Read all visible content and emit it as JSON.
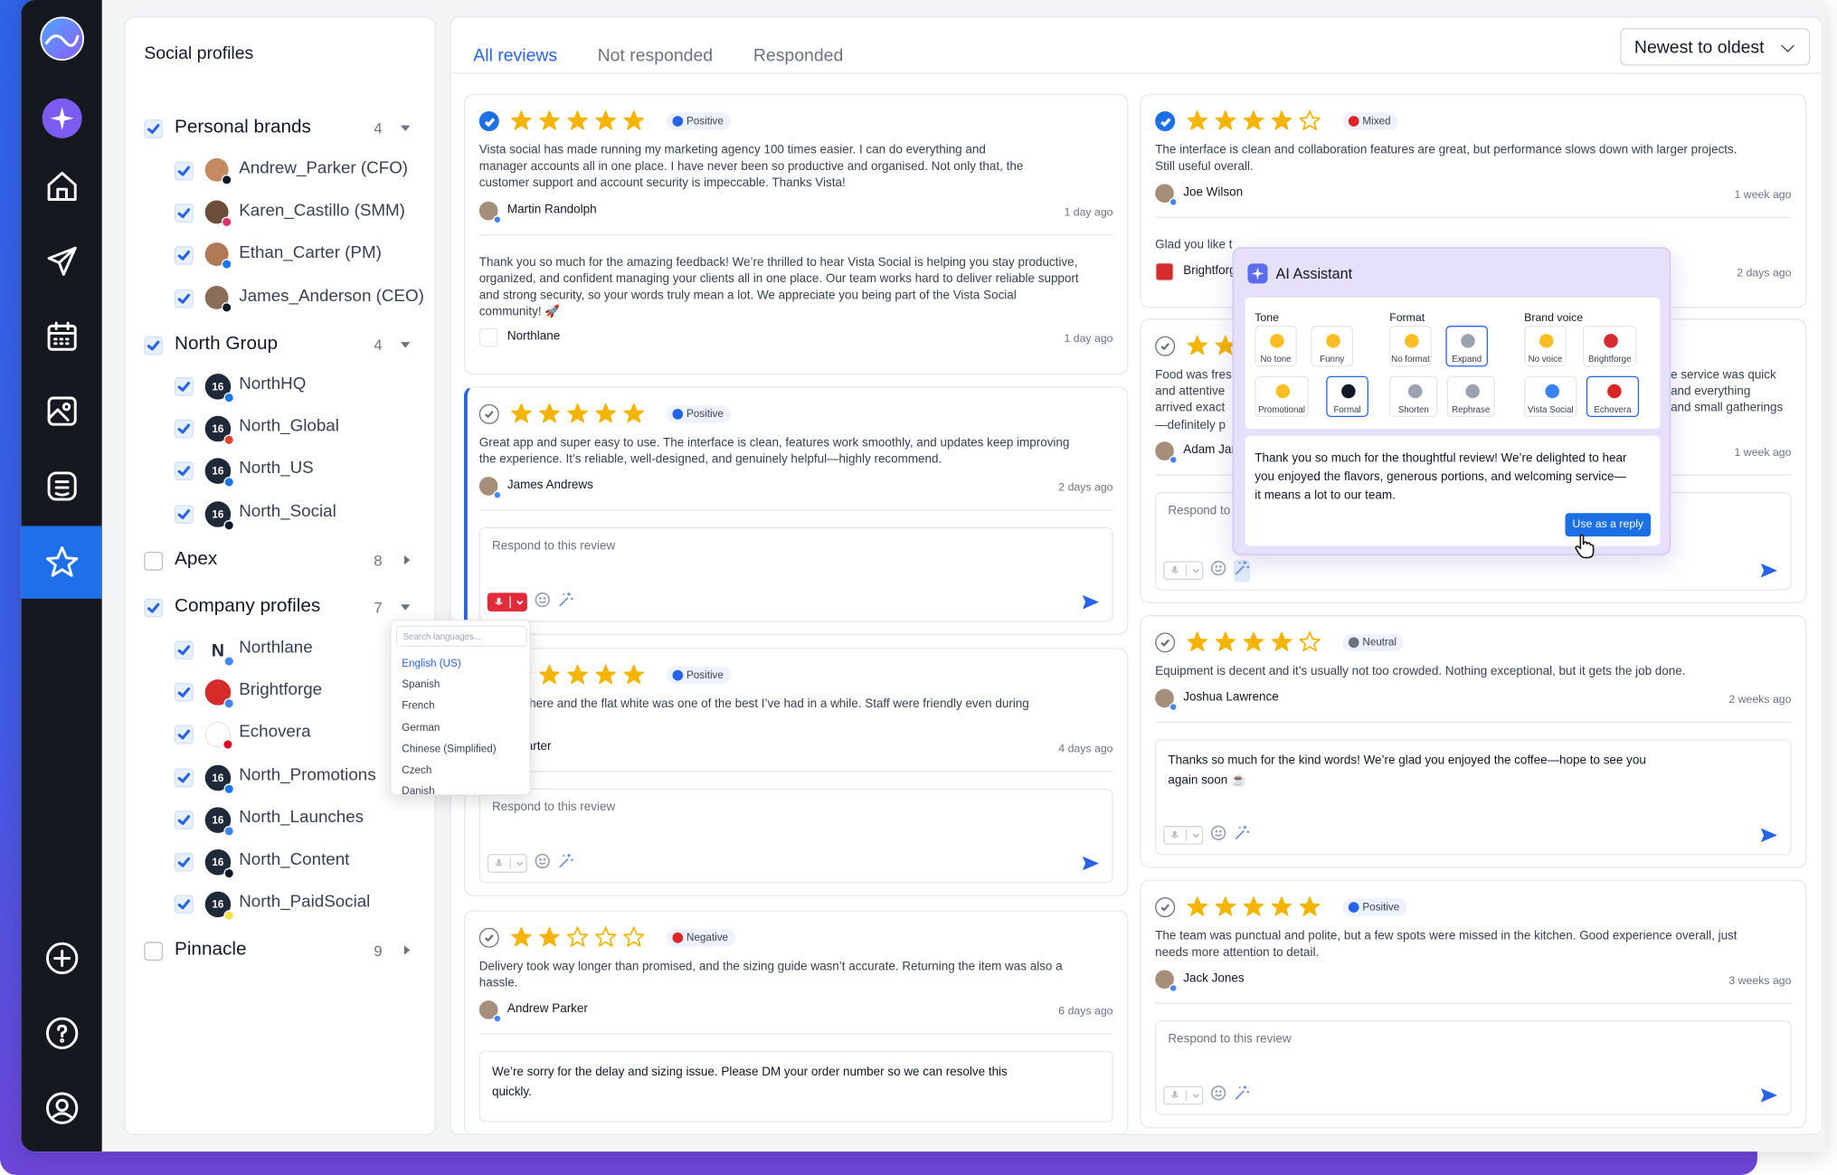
{
  "sidebar": {
    "title": "Social profiles",
    "groups": [
      {
        "label": "Personal brands",
        "count": "4",
        "checked": true,
        "expanded": true,
        "items": [
          "Andrew_Parker (CFO)",
          "Karen_Castillo (SMM)",
          "Ethan_Carter (PM)",
          "James_Anderson (CEO)"
        ]
      },
      {
        "label": "North Group",
        "count": "4",
        "checked": true,
        "expanded": true,
        "items": [
          "NorthHQ",
          "North_Global",
          "North_US",
          "North_Social"
        ]
      },
      {
        "label": "Apex",
        "count": "8",
        "checked": false,
        "expanded": false
      },
      {
        "label": "Company profiles",
        "count": "7",
        "checked": true,
        "expanded": true,
        "items": [
          "Northlane",
          "Brightforge",
          "Echovera",
          "North_Promotions",
          "North_Launches",
          "North_Content",
          "North_PaidSocial"
        ]
      },
      {
        "label": "Pinnacle",
        "count": "9",
        "checked": false,
        "expanded": false
      }
    ]
  },
  "language_dropdown": {
    "placeholder": "Search languages...",
    "options": [
      "English (US)",
      "Spanish",
      "French",
      "German",
      "Chinese (Simplified)",
      "Czech",
      "Danish"
    ],
    "selected": "English (US)"
  },
  "tabs": [
    "All reviews",
    "Not responded",
    "Responded"
  ],
  "active_tab": "All reviews",
  "sort": {
    "label": "Newest to oldest"
  },
  "reply_placeholder": "Respond to this review",
  "reviews": [
    {
      "stars": 5,
      "sentiment": "Positive",
      "checked": true,
      "text": [
        "Vista social has made running my marketing agency 100 times easier. I can do everything and",
        "manager accounts all in one place. I have never been so productive and organised. Not only that, the",
        "customer support and account security is impeccable. Thanks Vista!"
      ],
      "author": "Martin Randolph",
      "time": "1 day ago",
      "reply": {
        "text": [
          "Thank you so much for the amazing feedback! We’re thrilled to hear Vista Social is helping you stay productive,",
          "organized, and confident managing your clients all in one place. Our team works hard to deliver reliable support",
          "and strong security, so your words truly mean a lot. We appreciate you being part of the Vista Social",
          "community! 🚀"
        ],
        "author": "Northlane",
        "time": "1 day ago"
      }
    },
    {
      "stars": 5,
      "sentiment": "Positive",
      "checked": false,
      "text": [
        "Great app and super easy to use. The interface is clean, features work smoothly, and updates keep improving",
        "the experience. It’s reliable, well-designed, and genuinely helpful—highly recommend."
      ],
      "author": "James Andrews",
      "time": "2 days ago"
    },
    {
      "stars": 5,
      "sentiment": "Positive",
      "checked": false,
      "text": [
        "e atmosphere and the flat white was one of the best I’ve had in a while. Staff were friendly even during",
        "ing rush."
      ],
      "author": "n Carter",
      "time": "4 days ago"
    },
    {
      "stars": 2,
      "sentiment": "Negative",
      "checked": false,
      "text": [
        "Delivery took way longer than promised, and the sizing guide wasn’t accurate. Returning the item was also a",
        "hassle."
      ],
      "author": "Andrew Parker",
      "time": "6 days ago",
      "draft": [
        "We’re sorry for the delay and sizing issue. Please DM your order number so we can resolve this",
        "quickly."
      ]
    },
    {
      "stars": 4,
      "sentiment": "Mixed",
      "checked": true,
      "text": [
        "The interface is clean and collaboration features are great, but performance slows down with larger projects.",
        "Still useful overall."
      ],
      "author": "Joe Wilson",
      "time": "1 week ago",
      "reply": {
        "text": [
          "Glad you like t"
        ],
        "author": "Brightforg",
        "time": "2 days ago"
      }
    },
    {
      "stars": 5,
      "sentiment": "",
      "checked": false,
      "text_left": [
        "Food was fres",
        "and attentive",
        "arrived exact",
        "—definitely p"
      ],
      "text_right": [
        "e service was quick",
        "and everything",
        "and small gatherings"
      ],
      "author": "Adam Jan",
      "time": "1 week ago"
    },
    {
      "stars": 4,
      "sentiment": "Neutral",
      "checked": false,
      "text": [
        "Equipment is decent and it’s usually not too crowded. Nothing exceptional, but it gets the job done."
      ],
      "author": "Joshua Lawrence",
      "time": "2 weeks ago",
      "draft": [
        "Thanks so much for the kind words! We’re glad you enjoyed the coffee—hope to see you",
        "again soon ☕"
      ]
    },
    {
      "stars": 5,
      "sentiment": "Positive",
      "checked": false,
      "text": [
        "The team was punctual and polite, but a few spots were missed in the kitchen. Good experience overall, just",
        "needs more attention to detail."
      ],
      "author": "Jack Jones",
      "time": "3 weeks ago"
    }
  ],
  "ai_assistant": {
    "title": "AI Assistant",
    "tone": {
      "label": "Tone",
      "options": [
        "No tone",
        "Funny",
        "Promotional",
        "Formal"
      ],
      "selected": "Formal"
    },
    "format": {
      "label": "Format",
      "options": [
        "No format",
        "Expand",
        "Shorten",
        "Rephrase"
      ],
      "selected": "Expand"
    },
    "brand_voice": {
      "label": "Brand voice",
      "options": [
        "No voice",
        "Brightforge",
        "Vista Social",
        "Echovera"
      ],
      "selected": "Echovera"
    },
    "response": [
      "Thank you so much for the thoughtful review! We’re delighted to hear",
      "you enjoyed the flavors, generous portions, and welcoming service—",
      "it means a lot to our team."
    ],
    "use_button": "Use as a reply"
  },
  "colors": {
    "accent": "#2563eb",
    "star": "#f5b400",
    "rail": "#15181f",
    "ai_panel": "#e7e0fb"
  }
}
